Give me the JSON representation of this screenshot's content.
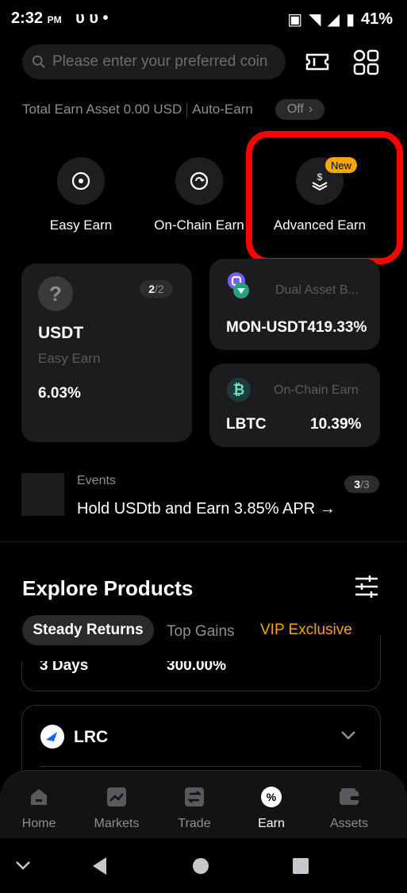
{
  "status": {
    "time": "2:32",
    "ampm": "PM",
    "battery": "41%"
  },
  "search": {
    "placeholder": "Please enter your preferred coin"
  },
  "summary": {
    "total_label": "Total Earn Asset 0.00 USD",
    "auto_earn_label": "Auto-Earn",
    "auto_earn_state": "Off"
  },
  "quick_actions": [
    {
      "label": "Easy Earn",
      "icon": "target-icon"
    },
    {
      "label": "On-Chain Earn",
      "icon": "chain-refresh-icon"
    },
    {
      "label": "Advanced Earn",
      "icon": "layers-dollar-icon",
      "badge": "New"
    }
  ],
  "feature_card": {
    "pager_current": "2",
    "pager_total": "/2",
    "coin": "USDT",
    "product": "Easy Earn",
    "apr": "6.03%"
  },
  "dual_card": {
    "product": "Dual Asset B...",
    "pair": "MON-USDT",
    "apr": "419.33%"
  },
  "onchain_card": {
    "product": "On-Chain Earn",
    "coin": "LBTC",
    "apr": "10.39%"
  },
  "events": {
    "label": "Events",
    "pager_current": "3",
    "pager_total": "/3",
    "headline": "Hold USDtb and Earn 3.85% APR →"
  },
  "explore": {
    "title": "Explore Products",
    "tabs": [
      "Steady Returns",
      "Top Gains",
      "VIP Exclusive"
    ],
    "partial_row": {
      "term": "3 Days",
      "apr": "300.00%"
    },
    "lrc_coin": "LRC"
  },
  "bottom_nav": [
    {
      "label": "Home",
      "icon": "home-icon"
    },
    {
      "label": "Markets",
      "icon": "chart-icon"
    },
    {
      "label": "Trade",
      "icon": "trade-icon"
    },
    {
      "label": "Earn",
      "icon": "percent-icon"
    },
    {
      "label": "Assets",
      "icon": "wallet-icon"
    }
  ],
  "colors": {
    "accent": "#f7a600",
    "highlight": "#ff0000",
    "card_bg": "#1c1c1e",
    "muted": "#8e8e93"
  }
}
